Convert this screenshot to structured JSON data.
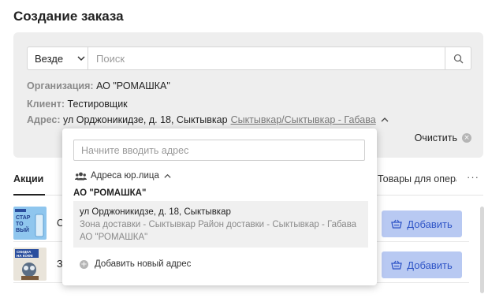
{
  "page": {
    "title": "Создание заказа"
  },
  "search": {
    "scope_value": "Везде",
    "placeholder": "Поиск"
  },
  "info": {
    "org_label": "Организация:",
    "org_value": "АО \"РОМАШКА\"",
    "client_label": "Клиент:",
    "client_value": "Тестировщик",
    "address_label": "Адрес:",
    "address_value": "ул Орджоникидзе, д. 18, Сыктывкар",
    "zone_link": "Сыктывкар/Сыктывкар - Габава"
  },
  "clear_label": "Очистить",
  "tabs": {
    "active": "Акции",
    "ops": "Товары для опера",
    "more": "···"
  },
  "products": [
    {
      "name": "С",
      "button": "Добавить",
      "thumb_text": [
        "СТАР",
        "ТО",
        "ВЫЙ"
      ]
    },
    {
      "name": "З",
      "button": "Добавить",
      "thumb_text": [
        "СКИДКА",
        "НА КОФЕ"
      ]
    }
  ],
  "dropdown": {
    "input_placeholder": "Начните вводить адрес",
    "group_label": "Адреса юр.лица",
    "org_name": "АО \"РОМАШКА\"",
    "item": {
      "address": "ул Орджоникидзе, д. 18, Сыктывкар",
      "zone": "Зона доставки - Сыктывкар Район доставки - Сыктывкар - Габава",
      "org": "АО \"РОМАШКА\""
    },
    "add_label": "Добавить новый адрес"
  },
  "colors": {
    "panel_bg": "#eeeeee",
    "button_bg": "#b8c9f2",
    "button_text": "#2f55c7"
  }
}
